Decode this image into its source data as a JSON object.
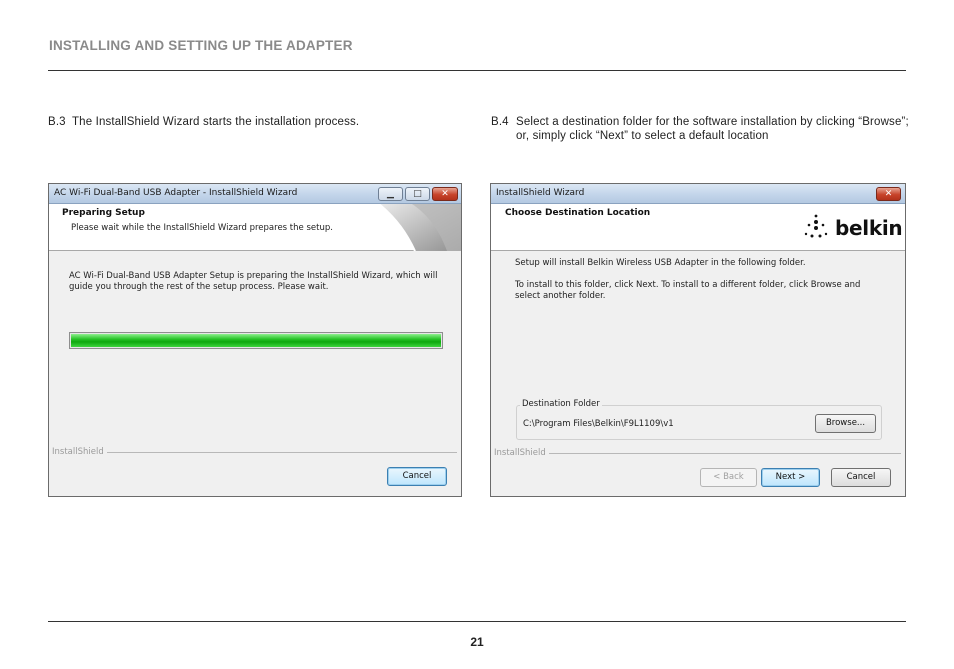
{
  "page": {
    "header": "INSTALLING AND SETTING UP THE ADAPTER",
    "page_number": "21"
  },
  "steps": {
    "b3": {
      "num": "B.3",
      "text": "The InstallShield Wizard starts the installation process."
    },
    "b4": {
      "num": "B.4",
      "text": "Select a destination folder for the software installation by clicking “Browse”; or, simply click “Next” to select a default location"
    }
  },
  "dialog1": {
    "title": "AC Wi-Fi Dual-Band USB Adapter - InstallShield Wizard",
    "header_title": "Preparing Setup",
    "header_subtitle": "Please wait while the InstallShield Wizard prepares the setup.",
    "body": "AC Wi-Fi Dual-Band USB Adapter Setup is preparing the InstallShield Wizard, which will guide you through the rest of the setup process. Please wait.",
    "progress": 1.0,
    "brand": "InstallShield",
    "cancel_label": "Cancel",
    "titlebar_icons": {
      "minimize": "minimize-icon",
      "maximize": "maximize-icon",
      "close": "close-icon"
    }
  },
  "dialog2": {
    "title": "InstallShield Wizard",
    "header_title": "Choose Destination Location",
    "logo_text": "belkin",
    "intro": "Setup will install Belkin Wireless USB Adapter in the following folder.",
    "instructions": "To install to this folder, click Next. To install to a different folder, click Browse and select another folder.",
    "group_label": "Destination Folder",
    "folder_path": "C:\\Program Files\\Belkin\\F9L1109\\v1",
    "browse_label": "Browse...",
    "brand": "InstallShield",
    "back_label": "< Back",
    "next_label": "Next >",
    "cancel_label": "Cancel"
  },
  "colors": {
    "header_gray": "#8a8a8a",
    "progress_green": "#27c227",
    "titlebar_blue": "#c3d5ea",
    "close_red": "#c7432a"
  }
}
